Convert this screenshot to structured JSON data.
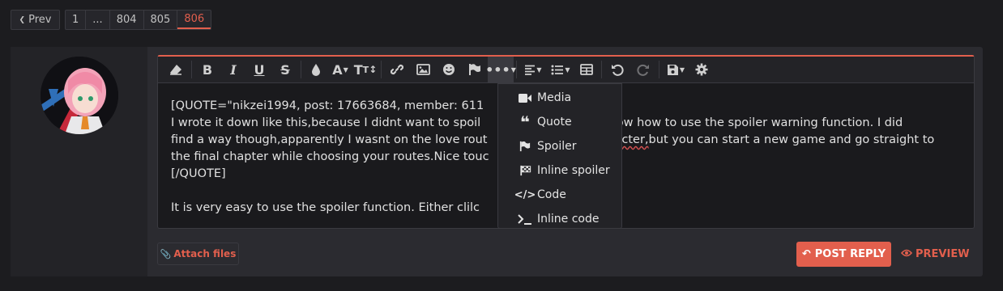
{
  "pagination": {
    "prev_label": "Prev",
    "pages": [
      "1",
      "...",
      "804",
      "805",
      "806"
    ],
    "current": "806"
  },
  "toolbar": {
    "buttons": [
      "eraser-icon",
      "bold-icon",
      "italic-icon",
      "underline-icon",
      "strikethrough-icon",
      "color-icon",
      "font-family-icon",
      "font-size-icon",
      "link-icon",
      "image-icon",
      "smiley-icon",
      "flag-icon",
      "more-icon",
      "align-icon",
      "list-icon",
      "table-icon",
      "undo-icon",
      "redo-icon",
      "save-icon",
      "settings-icon"
    ]
  },
  "editor": {
    "lines": [
      "[QUOTE=\"nikzei1994, post: 17663684, member: 611",
      "I wrote it down like this,because I didnt want to spoil",
      "find a way though,apparently I wasnt on the love rout",
      "the final chapter while choosing your routes.Nice touc",
      "[/QUOTE]",
      "",
      "It is very easy to use the spoiler function.  Either clilc"
    ],
    "line2_right": "know how to use the spoiler warning function. I did",
    "line3_right_a": "acter,",
    "line3_right_b": "but you can start a new game and go straight to"
  },
  "dropdown": {
    "items": [
      {
        "icon": "video-icon",
        "label": "Media"
      },
      {
        "icon": "quote-icon",
        "label": "Quote"
      },
      {
        "icon": "flag-icon",
        "label": "Spoiler"
      },
      {
        "icon": "checkered-flag-icon",
        "label": "Inline spoiler"
      },
      {
        "icon": "code-icon",
        "label": "Code"
      },
      {
        "icon": "terminal-icon",
        "label": "Inline code"
      }
    ]
  },
  "actions": {
    "attach_label": "Attach files",
    "post_reply_label": "POST REPLY",
    "preview_label": "PREVIEW"
  },
  "colors": {
    "accent": "#e25f4d",
    "background": "#1c1c1f",
    "panel": "#2b2b30"
  }
}
